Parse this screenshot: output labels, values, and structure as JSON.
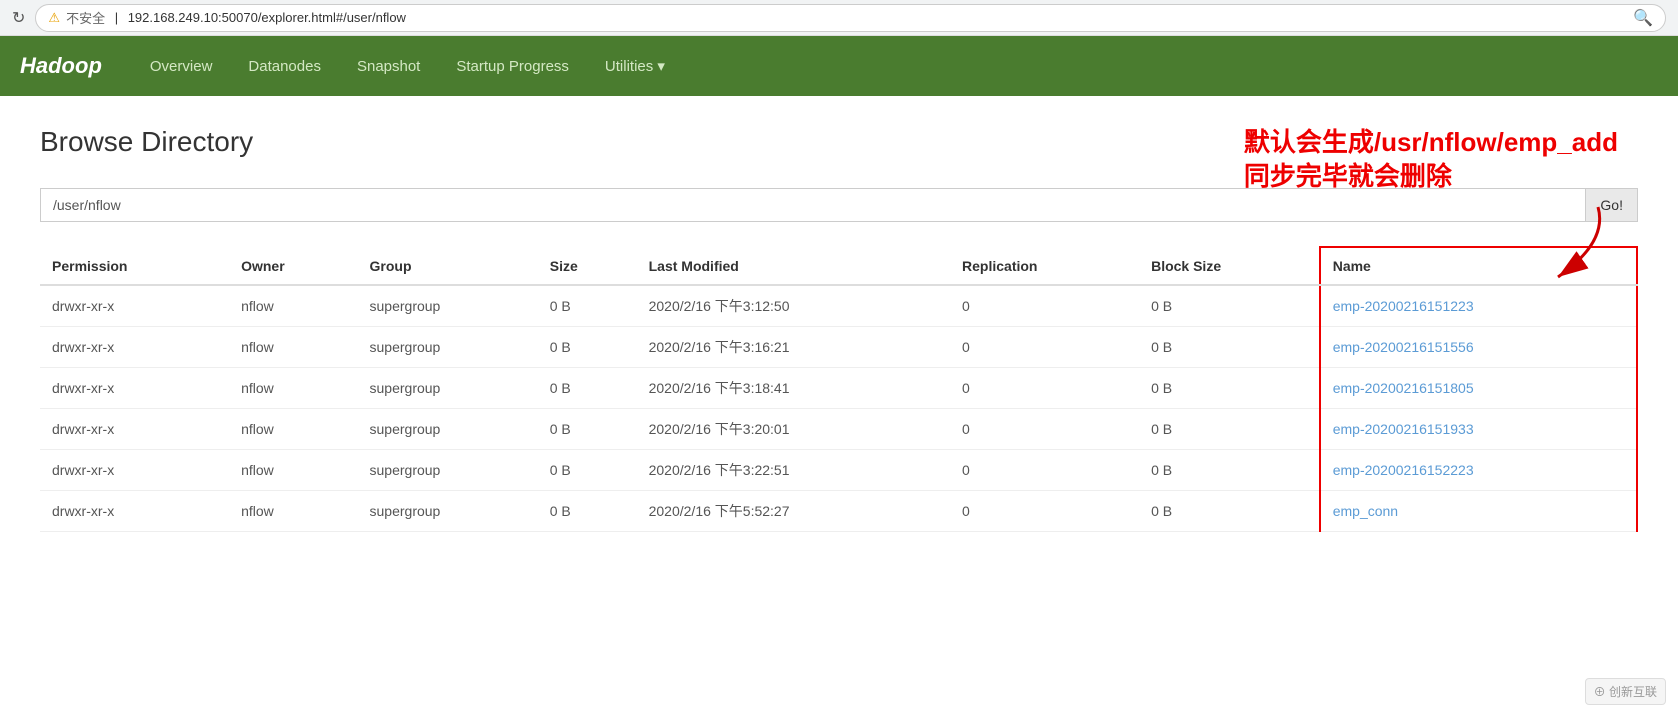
{
  "browser": {
    "reload_icon": "↻",
    "warning_icon": "⚠",
    "insecure_label": "不安全",
    "url": "192.168.249.10:50070/explorer.html#/user/nflow",
    "search_icon": "🔍"
  },
  "navbar": {
    "brand": "Hadoop",
    "links": [
      {
        "label": "Overview",
        "id": "overview"
      },
      {
        "label": "Datanodes",
        "id": "datanodes"
      },
      {
        "label": "Snapshot",
        "id": "snapshot"
      },
      {
        "label": "Startup Progress",
        "id": "startup-progress"
      },
      {
        "label": "Utilities ▾",
        "id": "utilities"
      }
    ]
  },
  "page": {
    "title": "Browse Directory",
    "path_value": "/user/nflow",
    "go_label": "Go!",
    "annotation_line1": "默认会生成/usr/nflow/emp_add",
    "annotation_line2": "同步完毕就会删除"
  },
  "table": {
    "headers": [
      "Permission",
      "Owner",
      "Group",
      "Size",
      "Last Modified",
      "Replication",
      "Block Size",
      "Name"
    ],
    "rows": [
      {
        "permission": "drwxr-xr-x",
        "owner": "nflow",
        "group": "supergroup",
        "size": "0 B",
        "last_modified": "2020/2/16 下午3:12:50",
        "replication": "0",
        "block_size": "0 B",
        "name": "emp-20200216151223"
      },
      {
        "permission": "drwxr-xr-x",
        "owner": "nflow",
        "group": "supergroup",
        "size": "0 B",
        "last_modified": "2020/2/16 下午3:16:21",
        "replication": "0",
        "block_size": "0 B",
        "name": "emp-20200216151556"
      },
      {
        "permission": "drwxr-xr-x",
        "owner": "nflow",
        "group": "supergroup",
        "size": "0 B",
        "last_modified": "2020/2/16 下午3:18:41",
        "replication": "0",
        "block_size": "0 B",
        "name": "emp-20200216151805"
      },
      {
        "permission": "drwxr-xr-x",
        "owner": "nflow",
        "group": "supergroup",
        "size": "0 B",
        "last_modified": "2020/2/16 下午3:20:01",
        "replication": "0",
        "block_size": "0 B",
        "name": "emp-20200216151933"
      },
      {
        "permission": "drwxr-xr-x",
        "owner": "nflow",
        "group": "supergroup",
        "size": "0 B",
        "last_modified": "2020/2/16 下午3:22:51",
        "replication": "0",
        "block_size": "0 B",
        "name": "emp-20200216152223"
      },
      {
        "permission": "drwxr-xr-x",
        "owner": "nflow",
        "group": "supergroup",
        "size": "0 B",
        "last_modified": "2020/2/16 下午5:52:27",
        "replication": "0",
        "block_size": "0 B",
        "name": "emp_conn"
      }
    ]
  },
  "watermark": {
    "label": "⊕ 创新互联"
  }
}
